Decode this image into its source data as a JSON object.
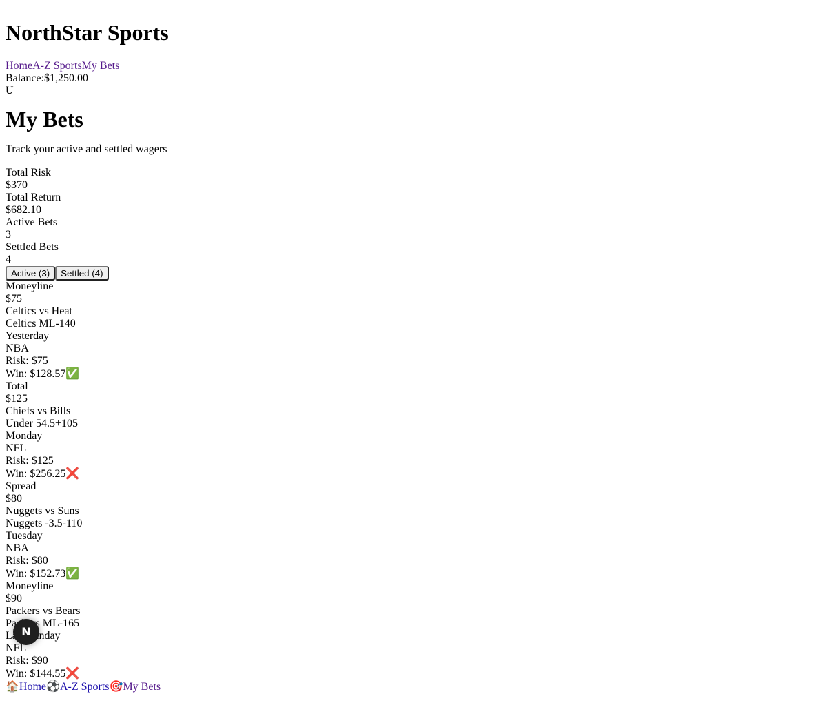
{
  "header": {
    "brand": "NorthStar Sports",
    "nav": [
      "Home",
      "A-Z Sports",
      "My Bets"
    ],
    "balance_label": "Balance:",
    "balance_value": "$1,250.00",
    "avatar": "U"
  },
  "main": {
    "title": "My Bets",
    "subtitle": "Track your active and settled wagers"
  },
  "stats": [
    {
      "label": "Total Risk",
      "value": "$370"
    },
    {
      "label": "Total Return",
      "value": "$682.10"
    },
    {
      "label": "Active Bets",
      "value": "3"
    },
    {
      "label": "Settled Bets",
      "value": "4"
    }
  ],
  "tabs": [
    "Active (3)",
    "Settled (4)"
  ],
  "bets": [
    {
      "type": "Moneyline",
      "stake": "$75",
      "matchup": "Celtics vs Heat",
      "selection": "Celtics ML-140",
      "when": "Yesterday",
      "league": "NBA",
      "risk": "Risk: $75",
      "win": "Win: $128.57",
      "status_icon": "✅",
      "status": "won"
    },
    {
      "type": "Total",
      "stake": "$125",
      "matchup": "Chiefs vs Bills",
      "selection": "Under 54.5+105",
      "when": "Monday",
      "league": "NFL",
      "risk": "Risk: $125",
      "win": "Win: $256.25",
      "status_icon": "❌",
      "status": "lost"
    },
    {
      "type": "Spread",
      "stake": "$80",
      "matchup": "Nuggets vs Suns",
      "selection": "Nuggets -3.5-110",
      "when": "Tuesday",
      "league": "NBA",
      "risk": "Risk: $80",
      "win": "Win: $152.73",
      "status_icon": "✅",
      "status": "won"
    },
    {
      "type": "Moneyline",
      "stake": "$90",
      "matchup": "Packers vs Bears",
      "selection": "Packers ML-165",
      "when": "Last Sunday",
      "league": "NFL",
      "risk": "Risk: $90",
      "win": "Win: $144.55",
      "status_icon": "❌",
      "status": "lost"
    }
  ],
  "bottom_nav": [
    {
      "icon": "🏠",
      "icon_name": "home-icon",
      "label": "Home"
    },
    {
      "icon": "⚽",
      "icon_name": "soccer-ball-icon",
      "label": "A-Z Sports"
    },
    {
      "icon": "🎯",
      "icon_name": "target-icon",
      "label": "My Bets"
    }
  ],
  "fab_letter": "N"
}
